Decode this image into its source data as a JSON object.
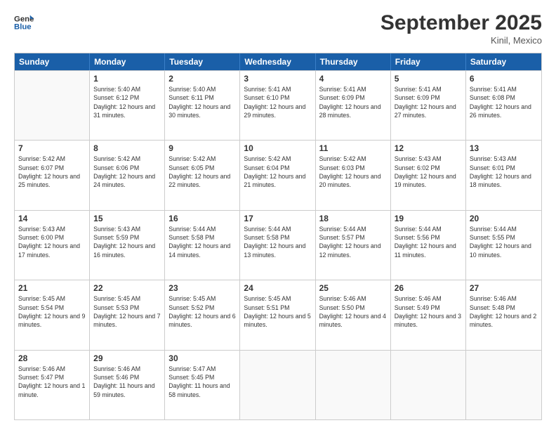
{
  "header": {
    "logo_line1": "General",
    "logo_line2": "Blue",
    "month": "September 2025",
    "location": "Kinil, Mexico"
  },
  "days_of_week": [
    "Sunday",
    "Monday",
    "Tuesday",
    "Wednesday",
    "Thursday",
    "Friday",
    "Saturday"
  ],
  "weeks": [
    [
      {
        "day": "",
        "empty": true
      },
      {
        "day": "1",
        "sunrise": "5:40 AM",
        "sunset": "6:12 PM",
        "daylight": "12 hours and 31 minutes."
      },
      {
        "day": "2",
        "sunrise": "5:40 AM",
        "sunset": "6:11 PM",
        "daylight": "12 hours and 30 minutes."
      },
      {
        "day": "3",
        "sunrise": "5:41 AM",
        "sunset": "6:10 PM",
        "daylight": "12 hours and 29 minutes."
      },
      {
        "day": "4",
        "sunrise": "5:41 AM",
        "sunset": "6:09 PM",
        "daylight": "12 hours and 28 minutes."
      },
      {
        "day": "5",
        "sunrise": "5:41 AM",
        "sunset": "6:09 PM",
        "daylight": "12 hours and 27 minutes."
      },
      {
        "day": "6",
        "sunrise": "5:41 AM",
        "sunset": "6:08 PM",
        "daylight": "12 hours and 26 minutes."
      }
    ],
    [
      {
        "day": "7",
        "sunrise": "5:42 AM",
        "sunset": "6:07 PM",
        "daylight": "12 hours and 25 minutes."
      },
      {
        "day": "8",
        "sunrise": "5:42 AM",
        "sunset": "6:06 PM",
        "daylight": "12 hours and 24 minutes."
      },
      {
        "day": "9",
        "sunrise": "5:42 AM",
        "sunset": "6:05 PM",
        "daylight": "12 hours and 22 minutes."
      },
      {
        "day": "10",
        "sunrise": "5:42 AM",
        "sunset": "6:04 PM",
        "daylight": "12 hours and 21 minutes."
      },
      {
        "day": "11",
        "sunrise": "5:42 AM",
        "sunset": "6:03 PM",
        "daylight": "12 hours and 20 minutes."
      },
      {
        "day": "12",
        "sunrise": "5:43 AM",
        "sunset": "6:02 PM",
        "daylight": "12 hours and 19 minutes."
      },
      {
        "day": "13",
        "sunrise": "5:43 AM",
        "sunset": "6:01 PM",
        "daylight": "12 hours and 18 minutes."
      }
    ],
    [
      {
        "day": "14",
        "sunrise": "5:43 AM",
        "sunset": "6:00 PM",
        "daylight": "12 hours and 17 minutes."
      },
      {
        "day": "15",
        "sunrise": "5:43 AM",
        "sunset": "5:59 PM",
        "daylight": "12 hours and 16 minutes."
      },
      {
        "day": "16",
        "sunrise": "5:44 AM",
        "sunset": "5:58 PM",
        "daylight": "12 hours and 14 minutes."
      },
      {
        "day": "17",
        "sunrise": "5:44 AM",
        "sunset": "5:58 PM",
        "daylight": "12 hours and 13 minutes."
      },
      {
        "day": "18",
        "sunrise": "5:44 AM",
        "sunset": "5:57 PM",
        "daylight": "12 hours and 12 minutes."
      },
      {
        "day": "19",
        "sunrise": "5:44 AM",
        "sunset": "5:56 PM",
        "daylight": "12 hours and 11 minutes."
      },
      {
        "day": "20",
        "sunrise": "5:44 AM",
        "sunset": "5:55 PM",
        "daylight": "12 hours and 10 minutes."
      }
    ],
    [
      {
        "day": "21",
        "sunrise": "5:45 AM",
        "sunset": "5:54 PM",
        "daylight": "12 hours and 9 minutes."
      },
      {
        "day": "22",
        "sunrise": "5:45 AM",
        "sunset": "5:53 PM",
        "daylight": "12 hours and 7 minutes."
      },
      {
        "day": "23",
        "sunrise": "5:45 AM",
        "sunset": "5:52 PM",
        "daylight": "12 hours and 6 minutes."
      },
      {
        "day": "24",
        "sunrise": "5:45 AM",
        "sunset": "5:51 PM",
        "daylight": "12 hours and 5 minutes."
      },
      {
        "day": "25",
        "sunrise": "5:46 AM",
        "sunset": "5:50 PM",
        "daylight": "12 hours and 4 minutes."
      },
      {
        "day": "26",
        "sunrise": "5:46 AM",
        "sunset": "5:49 PM",
        "daylight": "12 hours and 3 minutes."
      },
      {
        "day": "27",
        "sunrise": "5:46 AM",
        "sunset": "5:48 PM",
        "daylight": "12 hours and 2 minutes."
      }
    ],
    [
      {
        "day": "28",
        "sunrise": "5:46 AM",
        "sunset": "5:47 PM",
        "daylight": "12 hours and 1 minute."
      },
      {
        "day": "29",
        "sunrise": "5:46 AM",
        "sunset": "5:46 PM",
        "daylight": "11 hours and 59 minutes."
      },
      {
        "day": "30",
        "sunrise": "5:47 AM",
        "sunset": "5:45 PM",
        "daylight": "11 hours and 58 minutes."
      },
      {
        "day": "",
        "empty": true
      },
      {
        "day": "",
        "empty": true
      },
      {
        "day": "",
        "empty": true
      },
      {
        "day": "",
        "empty": true
      }
    ]
  ]
}
